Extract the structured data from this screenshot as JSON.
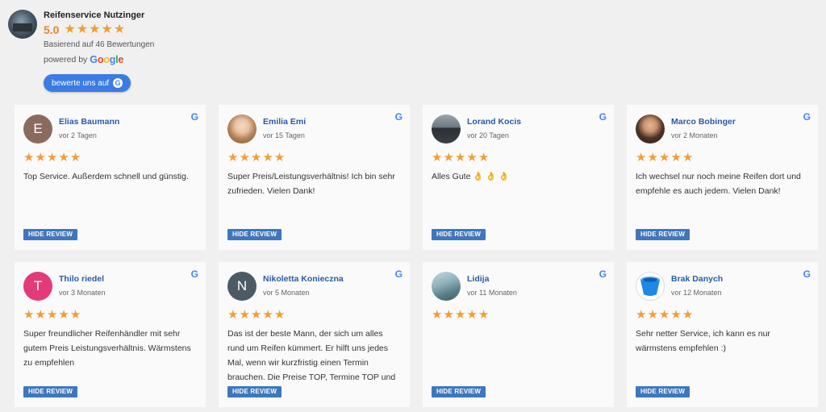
{
  "business": {
    "name": "Reifenservice Nutzinger",
    "rating": "5.0",
    "based_on": "Basierend auf 46 Bewertungen",
    "powered_by": "powered by",
    "google_word": "Google",
    "rate_button": "bewerte uns auf",
    "google_letter": "G"
  },
  "hide_label": "HIDE REVIEW",
  "reviews": [
    {
      "name": "Elias Baumann",
      "time": "vor 2 Tagen",
      "text": "Top Service. Außerdem schnell und günstig.",
      "initial": "E",
      "avatar_color": "#8b6a5e",
      "stars": 5
    },
    {
      "name": "Emilia Emi",
      "time": "vor 15 Tagen",
      "text": "Super Preis/Leistungsverhältnis! Ich bin sehr zufrieden. Vielen Dank!",
      "initial": "",
      "avatar_color": "#e3c9b6",
      "stars": 5
    },
    {
      "name": "Lorand Kocis",
      "time": "vor 20 Tagen",
      "text": "Alles Gute 👌 👌 👌",
      "initial": "",
      "avatar_color": "#4e555c",
      "stars": 5
    },
    {
      "name": "Marco Bobinger",
      "time": "vor 2 Monaten",
      "text": "Ich wechsel nur noch meine Reifen dort und empfehle es auch jedem. Vielen Dank!",
      "initial": "",
      "avatar_color": "#5b4030",
      "stars": 5
    },
    {
      "name": "Thilo riedel",
      "time": "vor 3 Monaten",
      "text": "Super freundlicher Reifenhändler mit sehr gutem Preis Leistungsverhältnis. Wärmstens zu empfehlen",
      "initial": "T",
      "avatar_color": "#e33b7a",
      "stars": 5
    },
    {
      "name": "Nikoletta Konieczna",
      "time": "vor 5 Monaten",
      "text": "Das ist der beste Mann, der sich um alles rund um Reifen kümmert. Er hilft uns jedes Mal, wenn wir kurzfristig einen Termin brauchen. Die Preise TOP, Termine TOP und",
      "initial": "N",
      "avatar_color": "#4c5a66",
      "stars": 5
    },
    {
      "name": "Lidija",
      "time": "vor 11 Monaten",
      "text": "",
      "initial": "",
      "avatar_color": "#6e9aa6",
      "stars": 5
    },
    {
      "name": "Brak Danych",
      "time": "vor 12 Monaten",
      "text": "Sehr netter Service, ich kann es nur wärmstens empfehlen :)",
      "initial": "",
      "avatar_color": "#ffffff",
      "stars": 5
    }
  ],
  "colors": {
    "star": "#f29d38",
    "accent": "#3b7be3",
    "name": "#2a5aa8",
    "hide_button": "#3f77bd"
  }
}
